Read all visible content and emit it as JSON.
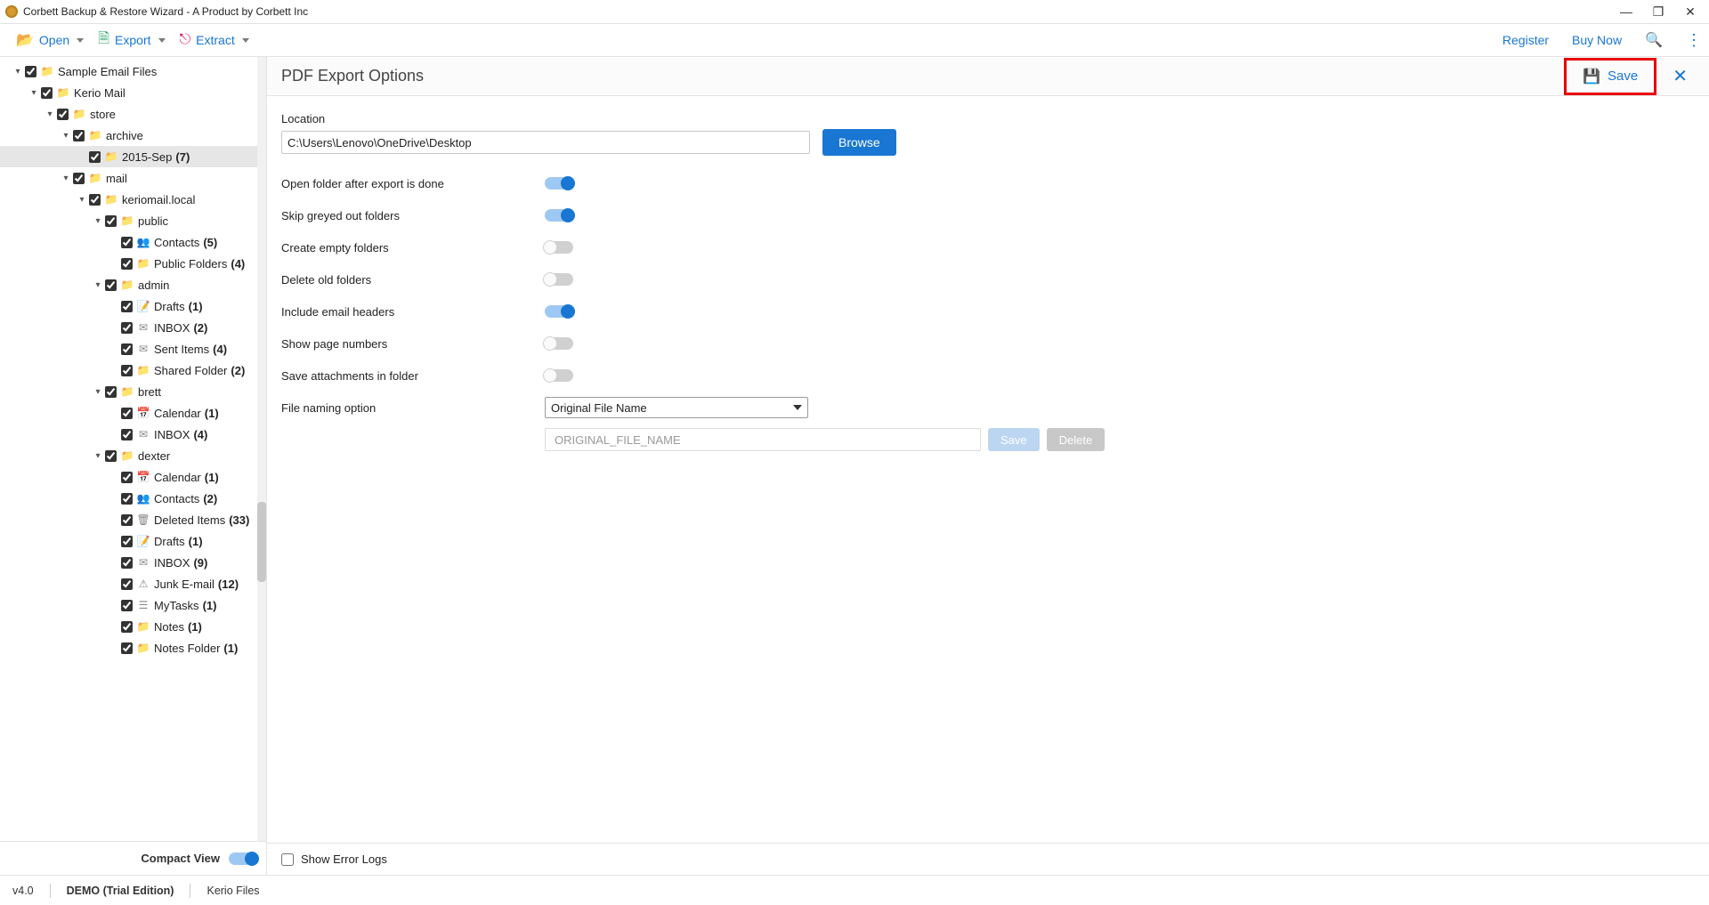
{
  "window": {
    "title": "Corbett Backup & Restore Wizard - A Product by Corbett Inc",
    "minimize": "—",
    "maximize": "❐",
    "close": "✕"
  },
  "toolbar": {
    "open": "Open",
    "export": "Export",
    "extract": "Extract",
    "register": "Register",
    "buy": "Buy Now"
  },
  "sidebar": {
    "compact_view": "Compact View",
    "tree": [
      {
        "depth": 0,
        "exp": "▾",
        "icon": "📁",
        "label": "Sample Email Files",
        "count": null
      },
      {
        "depth": 1,
        "exp": "▾",
        "icon": "📁",
        "label": "Kerio Mail",
        "count": null
      },
      {
        "depth": 2,
        "exp": "▾",
        "icon": "📁",
        "label": "store",
        "count": null
      },
      {
        "depth": 3,
        "exp": "▾",
        "icon": "📁",
        "label": "archive",
        "count": null
      },
      {
        "depth": 4,
        "exp": "",
        "icon": "📁",
        "label": "2015-Sep",
        "count": "(7)",
        "selected": true
      },
      {
        "depth": 3,
        "exp": "▾",
        "icon": "📁",
        "label": "mail",
        "count": null
      },
      {
        "depth": 4,
        "exp": "▾",
        "icon": "📁",
        "label": "keriomail.local",
        "count": null
      },
      {
        "depth": 5,
        "exp": "▾",
        "icon": "📁",
        "label": "public",
        "count": null
      },
      {
        "depth": 6,
        "exp": "",
        "icon": "👥",
        "label": "Contacts",
        "count": "(5)"
      },
      {
        "depth": 6,
        "exp": "",
        "icon": "📁",
        "label": "Public Folders",
        "count": "(4)"
      },
      {
        "depth": 5,
        "exp": "▾",
        "icon": "📁",
        "label": "admin",
        "count": null
      },
      {
        "depth": 6,
        "exp": "",
        "icon": "📝",
        "label": "Drafts",
        "count": "(1)"
      },
      {
        "depth": 6,
        "exp": "",
        "icon": "✉",
        "label": "INBOX",
        "count": "(2)"
      },
      {
        "depth": 6,
        "exp": "",
        "icon": "✉",
        "label": "Sent Items",
        "count": "(4)"
      },
      {
        "depth": 6,
        "exp": "",
        "icon": "📁",
        "label": "Shared Folder",
        "count": "(2)"
      },
      {
        "depth": 5,
        "exp": "▾",
        "icon": "📁",
        "label": "brett",
        "count": null
      },
      {
        "depth": 6,
        "exp": "",
        "icon": "📅",
        "label": "Calendar",
        "count": "(1)"
      },
      {
        "depth": 6,
        "exp": "",
        "icon": "✉",
        "label": "INBOX",
        "count": "(4)"
      },
      {
        "depth": 5,
        "exp": "▾",
        "icon": "📁",
        "label": "dexter",
        "count": null
      },
      {
        "depth": 6,
        "exp": "",
        "icon": "📅",
        "label": "Calendar",
        "count": "(1)"
      },
      {
        "depth": 6,
        "exp": "",
        "icon": "👥",
        "label": "Contacts",
        "count": "(2)"
      },
      {
        "depth": 6,
        "exp": "",
        "icon": "🗑",
        "label": "Deleted Items",
        "count": "(33)"
      },
      {
        "depth": 6,
        "exp": "",
        "icon": "📝",
        "label": "Drafts",
        "count": "(1)"
      },
      {
        "depth": 6,
        "exp": "",
        "icon": "✉",
        "label": "INBOX",
        "count": "(9)"
      },
      {
        "depth": 6,
        "exp": "",
        "icon": "⚠",
        "label": "Junk E-mail",
        "count": "(12)"
      },
      {
        "depth": 6,
        "exp": "",
        "icon": "☰",
        "label": "MyTasks",
        "count": "(1)"
      },
      {
        "depth": 6,
        "exp": "",
        "icon": "📁",
        "label": "Notes",
        "count": "(1)"
      },
      {
        "depth": 6,
        "exp": "",
        "icon": "📁",
        "label": "Notes Folder",
        "count": "(1)"
      }
    ]
  },
  "panel": {
    "title": "PDF Export Options",
    "save": "Save",
    "location_label": "Location",
    "location_value": "C:\\Users\\Lenovo\\OneDrive\\Desktop",
    "browse": "Browse",
    "toggles": [
      {
        "label": "Open folder after export is done",
        "on": true
      },
      {
        "label": "Skip greyed out folders",
        "on": true
      },
      {
        "label": "Create empty folders",
        "on": false
      },
      {
        "label": "Delete old folders",
        "on": false
      },
      {
        "label": "Include email headers",
        "on": true
      },
      {
        "label": "Show page numbers",
        "on": false
      },
      {
        "label": "Save attachments in folder",
        "on": false
      }
    ],
    "naming_label": "File naming option",
    "naming_selected": "Original File Name",
    "naming_preview": "ORIGINAL_FILE_NAME",
    "naming_save": "Save",
    "naming_delete": "Delete",
    "show_error_logs": "Show Error Logs"
  },
  "status": {
    "version": "v4.0",
    "demo": "DEMO (Trial Edition)",
    "source": "Kerio Files"
  }
}
